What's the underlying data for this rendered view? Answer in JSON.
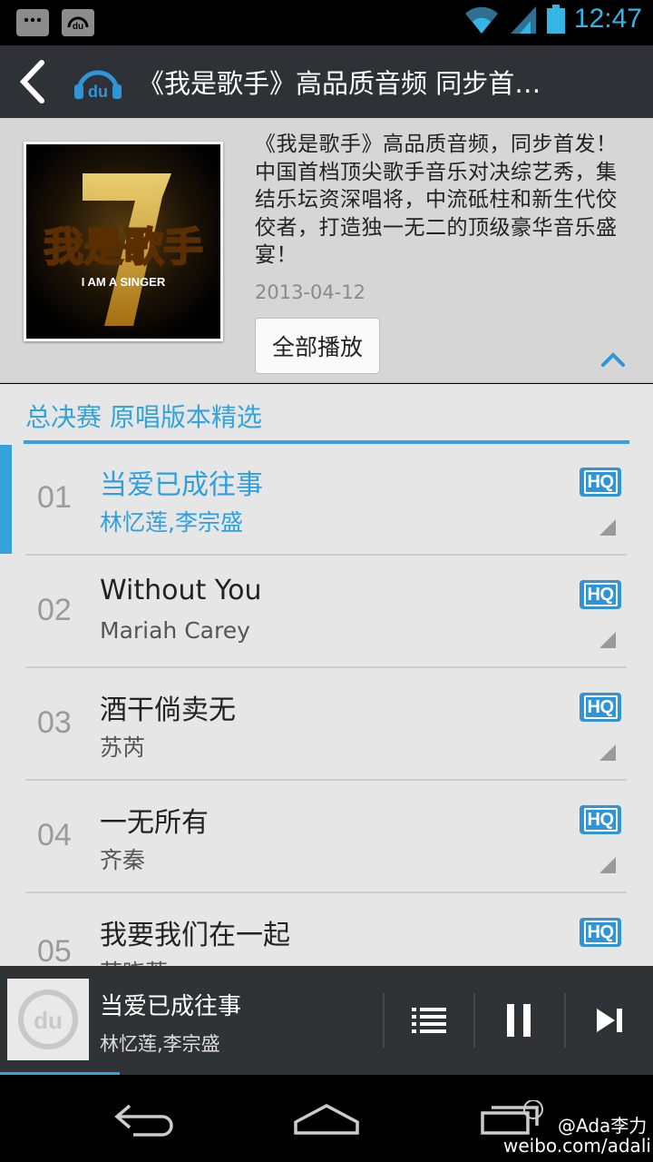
{
  "status_bar": {
    "time": "12:47",
    "icons": [
      "chat-icon",
      "baidu-music-icon",
      "wifi-icon",
      "signal-icon",
      "battery-icon"
    ]
  },
  "action_bar": {
    "title": "《我是歌手》高品质音频 同步首…"
  },
  "album": {
    "cover_text": "我是歌手",
    "cover_subtext": "I AM A SINGER",
    "description": "《我是歌手》高品质音频，同步首发！中国首档顶尖歌手音乐对决综艺秀，集结乐坛资深唱将，中流砥柱和新生代佼佼者，打造独一无二的顶级豪华音乐盛宴！",
    "date": "2013-04-12",
    "play_all_label": "全部播放"
  },
  "list": {
    "section_title": "总决赛 原唱版本精选",
    "hq_label": "HQ",
    "tracks": [
      {
        "num": "01",
        "name": "当爱已成往事",
        "artist": "林忆莲,李宗盛"
      },
      {
        "num": "02",
        "name": "Without You",
        "artist": "Mariah Carey"
      },
      {
        "num": "03",
        "name": "酒干倘卖无",
        "artist": "苏芮"
      },
      {
        "num": "04",
        "name": "一无所有",
        "artist": "齐秦"
      },
      {
        "num": "05",
        "name": "我要我们在一起",
        "artist": "范晓萱"
      }
    ]
  },
  "now_playing": {
    "title": "当爱已成往事",
    "artist": "林忆莲,李宗盛"
  },
  "watermark": {
    "line1": "@Ada李力",
    "line2": "weibo.com/adali"
  },
  "colors": {
    "accent": "#33a3dc",
    "action_bar": "#2e3135",
    "list_bg": "#e6e6e6",
    "header_bg": "#d6d6d6",
    "hq_badge": "#2f95d8"
  }
}
